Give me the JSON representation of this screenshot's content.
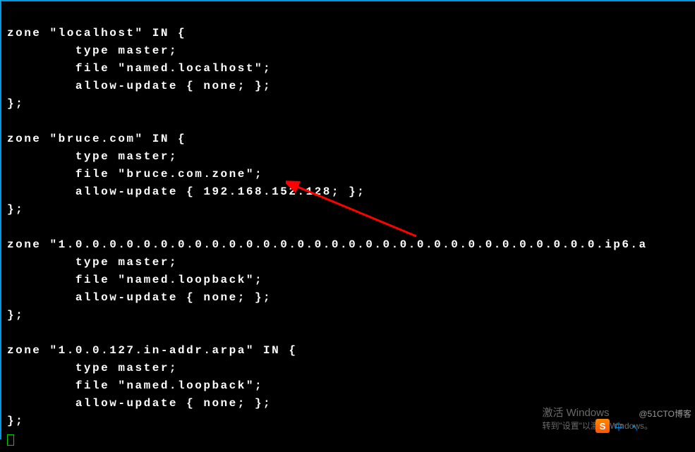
{
  "terminal": {
    "lines": [
      "zone \"localhost\" IN {",
      "        type master;",
      "        file \"named.localhost\";",
      "        allow-update { none; };",
      "};",
      "",
      "zone \"bruce.com\" IN {",
      "        type master;",
      "        file \"bruce.com.zone\";",
      "        allow-update { 192.168.152.128; };",
      "};",
      "",
      "zone \"1.0.0.0.0.0.0.0.0.0.0.0.0.0.0.0.0.0.0.0.0.0.0.0.0.0.0.0.0.0.0.0.ip6.a",
      "        type master;",
      "        file \"named.loopback\";",
      "        allow-update { none; };",
      "};",
      "",
      "zone \"1.0.0.127.in-addr.arpa\" IN {",
      "        type master;",
      "        file \"named.loopback\";",
      "        allow-update { none; };",
      "};"
    ]
  },
  "watermark": {
    "activate_line1": "激活 Windows",
    "activate_line2": "转到\"设置\"以激活 Windows。",
    "blog": "@51CTO博客"
  },
  "ime": {
    "s_icon": "S",
    "zhong": "中",
    "punct": "•,"
  },
  "annotation": {
    "arrow_color": "#ff0000"
  }
}
